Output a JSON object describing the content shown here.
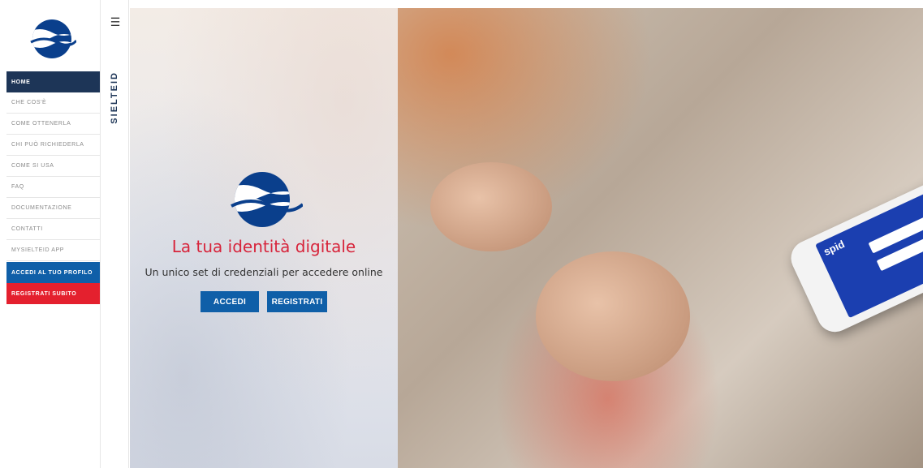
{
  "sidebar": {
    "logo_icon": "sielteid-wave-logo",
    "items": [
      {
        "label": "HOME",
        "state": "active"
      },
      {
        "label": "CHE COS'È",
        "state": "normal"
      },
      {
        "label": "COME OTTENERLA",
        "state": "normal"
      },
      {
        "label": "CHI PUÒ RICHIEDERLA",
        "state": "normal"
      },
      {
        "label": "COME SI USA",
        "state": "normal"
      },
      {
        "label": "FAQ",
        "state": "normal"
      },
      {
        "label": "DOCUMENTAZIONE",
        "state": "normal"
      },
      {
        "label": "CONTATTI",
        "state": "normal"
      },
      {
        "label": "MYSIELTEID APP",
        "state": "normal"
      },
      {
        "label": "ACCEDI AL TUO PROFILO",
        "state": "profile"
      },
      {
        "label": "REGISTRATI SUBITO",
        "state": "register"
      }
    ]
  },
  "strip": {
    "menu_icon": "hamburger-menu-icon",
    "brand": "SIELTEID"
  },
  "hero": {
    "title": "La tua identità digitale",
    "subtitle": "Un unico set di credenziali per accedere online",
    "accedi_label": "ACCEDI",
    "registrati_label": "REGISTRATI",
    "phone_screen_label": "spid"
  },
  "colors": {
    "nav_active": "#1d3557",
    "accent_blue": "#0f5fa8",
    "accent_red": "#e4202e",
    "title_red": "#d7243b"
  }
}
